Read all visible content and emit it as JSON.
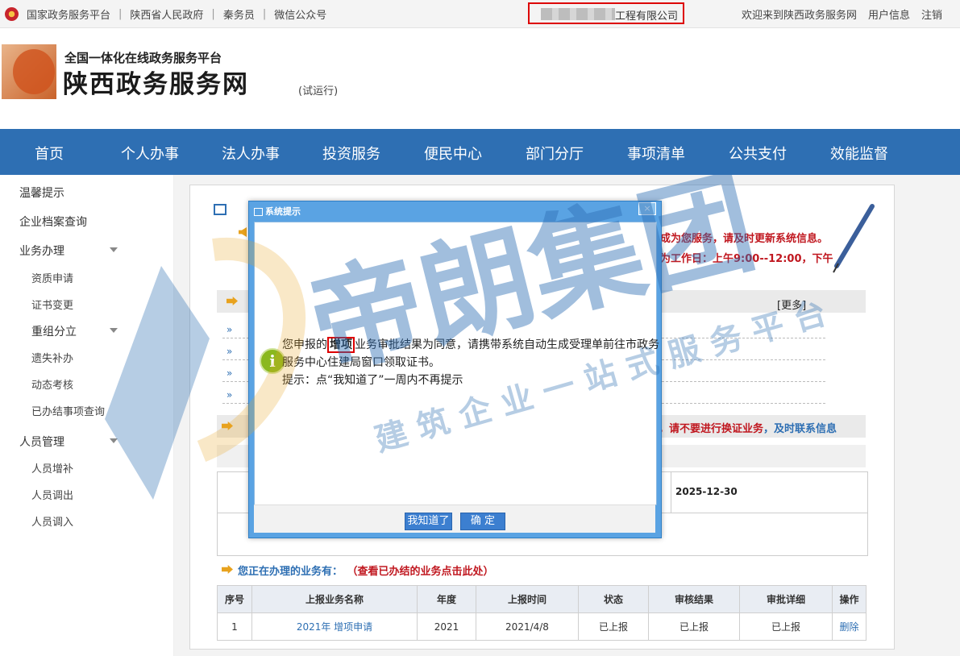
{
  "topbar": {
    "links": [
      "国家政务服务平台",
      "陕西省人民政府",
      "秦务员",
      "微信公众号"
    ],
    "company_suffix": "工程有限公司",
    "welcome": "欢迎来到陕西政务服务网",
    "user_info": "用户信息",
    "logout": "注销"
  },
  "header": {
    "sub_title": "全国一体化在线政务服务平台",
    "main_title": "陕西政务服务网",
    "trial": "(试运行)"
  },
  "nav": [
    "首页",
    "个人办事",
    "法人办事",
    "投资服务",
    "便民中心",
    "部门分厅",
    "事项清单",
    "公共支付",
    "效能监督"
  ],
  "sidebar": {
    "items": [
      "温馨提示",
      "企业档案查询",
      "业务办理",
      "资质申请",
      "证书变更",
      "重组分立",
      "遗失补办",
      "动态考核",
      "已办结事项查询",
      "人员管理",
      "人员增补",
      "人员调出",
      "人员调入"
    ]
  },
  "main": {
    "notice1": "成为您服务，请及时更新系统信息。",
    "notice2": "为工作日：上午9:00--12:00，下午",
    "more": "[更多]",
    "warning_red": "误，请不要进行换证业务",
    "warning_blue": "，及时联系信息",
    "date_value": "2025-12-30",
    "business_heading": "您正在办理的业务有：",
    "business_link": "（查看已办结的业务点击此处）",
    "table": {
      "headers": [
        "序号",
        "上报业务名称",
        "年度",
        "上报时间",
        "状态",
        "审核结果",
        "审批详细",
        "操作"
      ],
      "rows": [
        [
          "1",
          "2021年 增项申请",
          "2021",
          "2021/4/8",
          "已上报",
          "已上报",
          "已上报",
          "删除"
        ]
      ]
    }
  },
  "dialog": {
    "title": "系统提示",
    "close": "×",
    "msg_prefix": "您申报的",
    "msg_highlight": "增项",
    "msg_rest": "业务审批结果为同意，请携带系统自动生成受理单前往市政务服务中心住建局窗口领取证书。",
    "msg_hint": "提示：点“我知道了”一周内不再提示",
    "btn_know": "我知道了",
    "btn_ok": "确 定"
  },
  "watermark": {
    "big": "帝朗集团",
    "small": "建筑企业一站式服务平台"
  }
}
